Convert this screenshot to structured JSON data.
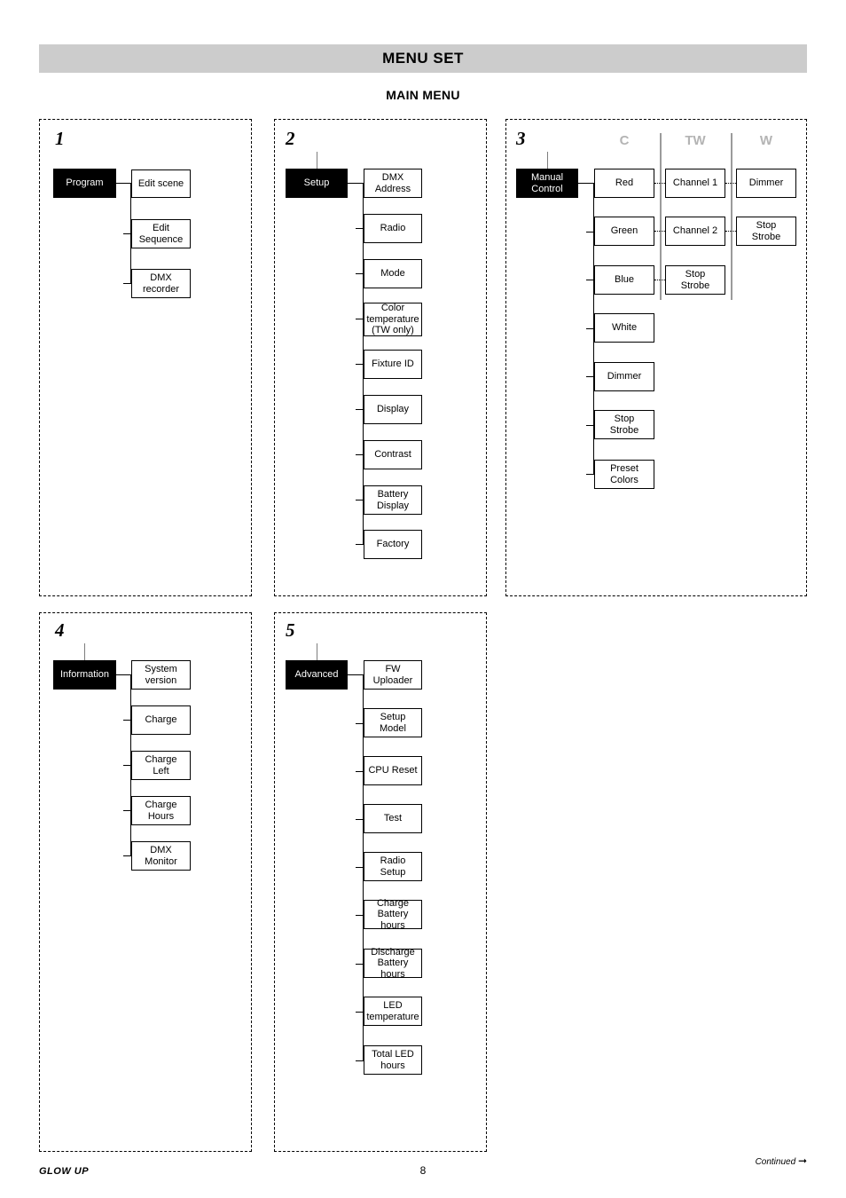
{
  "header": {
    "title": "MENU SET",
    "subtitle": "MAIN MENU"
  },
  "panels": [
    {
      "number": "1",
      "root": "Program",
      "items": [
        "Edit scene",
        "Edit\nSequence",
        "DMX\nrecorder"
      ]
    },
    {
      "number": "2",
      "root": "Setup",
      "items": [
        "DMX\nAddress",
        "Radio",
        "Mode",
        "Color\ntemperature\n(TW only)",
        "Fixture ID",
        "Display",
        "Contrast",
        "Battery\nDisplay",
        "Factory"
      ]
    },
    {
      "number": "3",
      "root": "Manual\nControl",
      "group_headers": [
        "C",
        "TW",
        "W"
      ],
      "columns": {
        "c": [
          "Red",
          "Green",
          "Blue",
          "White",
          "Dimmer",
          "Stop\nStrobe",
          "Preset\nColors"
        ],
        "tw": [
          "Channel 1",
          "Channel 2",
          "Stop\nStrobe"
        ],
        "w": [
          "Dimmer",
          "Stop\nStrobe"
        ]
      }
    },
    {
      "number": "4",
      "root": "Information",
      "items": [
        "System\nversion",
        "Charge",
        "Charge\nLeft",
        "Charge\nHours",
        "DMX\nMonitor"
      ]
    },
    {
      "number": "5",
      "root": "Advanced",
      "items": [
        "FW\nUploader",
        "Setup Model",
        "CPU Reset",
        "Test",
        "Radio Setup",
        "Charge\nBattery hours",
        "Discharge\nBattery hours",
        "LED\ntemperature",
        "Total LED\nhours"
      ]
    }
  ],
  "footer": {
    "brand": "GLOW UP",
    "page": "8",
    "continued": "Continued"
  },
  "colors": {
    "title_bar": "#cccccc",
    "root_box": "#000000",
    "group_header": "#b4b4b4",
    "divider": "#9b9b9b"
  }
}
